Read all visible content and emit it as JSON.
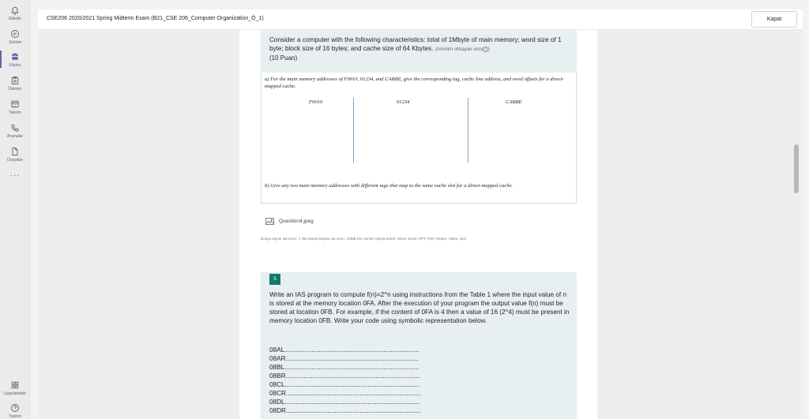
{
  "rail": {
    "items": [
      {
        "label": "Etkinlik",
        "icon": "bell-icon"
      },
      {
        "label": "Sohbet",
        "icon": "chat-icon"
      },
      {
        "label": "Ekipler",
        "icon": "teams-icon"
      },
      {
        "label": "Ödevler",
        "icon": "assignments-icon"
      },
      {
        "label": "Takvim",
        "icon": "calendar-icon"
      },
      {
        "label": "Aramalar",
        "icon": "phone-icon"
      },
      {
        "label": "Dosyalar",
        "icon": "files-icon"
      }
    ],
    "more": "···",
    "apps_label": "Uygulamalar",
    "help_label": "Yardım",
    "accent": "#6264a7"
  },
  "header": {
    "title": "CSE206 2020/2021 Spring Midterm Exam (B21_CSE 206_Computer Organization_Ö_1)",
    "close_label": "Kapat"
  },
  "q4": {
    "text": "Consider a computer with the following characteristics: total of 1Mbyte of main memory; word size of 1 byte; block size of 16 bytes; and cache size of 64 Kbytes.",
    "meta": "(Anonim olmayan soru",
    "meta_end": ")",
    "points": "(10 Puan)",
    "image": {
      "part_a": "a)   For the main memory addresses of F0010, 01234, and CABBE, give the corresponding tag, cache line address, and word offsets for a direct-mapped cache.",
      "col1": "F0010",
      "col2": "01234",
      "col3": "CABBE",
      "part_b": "b)   Give any two main memory addresses with different tags that map to the same cache slot for a direct-mapped cache."
    },
    "attachment": "Question4.jpeg",
    "limits": "Dosya sayısı üst sınırı: 1     Tek dosya boyutu üst sınırı: 10MB     İzin verilen dosya türleri: Word, Excel, PPT, PDF, Resim, Video, Ses"
  },
  "q5": {
    "number": "5",
    "text": "Write an IAS program to compute f(n)=2^n using instructions from the Table 1 where the input value of n is stored at the memory location 0FA. After the execution of your program the output value f(n) must be stored at location 0FB. For example, if the content of 0FA is 4 then a value of 16 (2^4) must be present in memory location 0FB. Write your code using symbolic representation below.",
    "lines": [
      "08AL...........................................................................",
      "08AR..........................................................................",
      "08BL...........................................................................",
      "08BR...........................................................................",
      "08CL...........................................................................",
      "08CR...........................................................................",
      "08DL...........................................................................",
      "08DR..........................................................................."
    ],
    "badge_color": "#0f7b6b"
  }
}
